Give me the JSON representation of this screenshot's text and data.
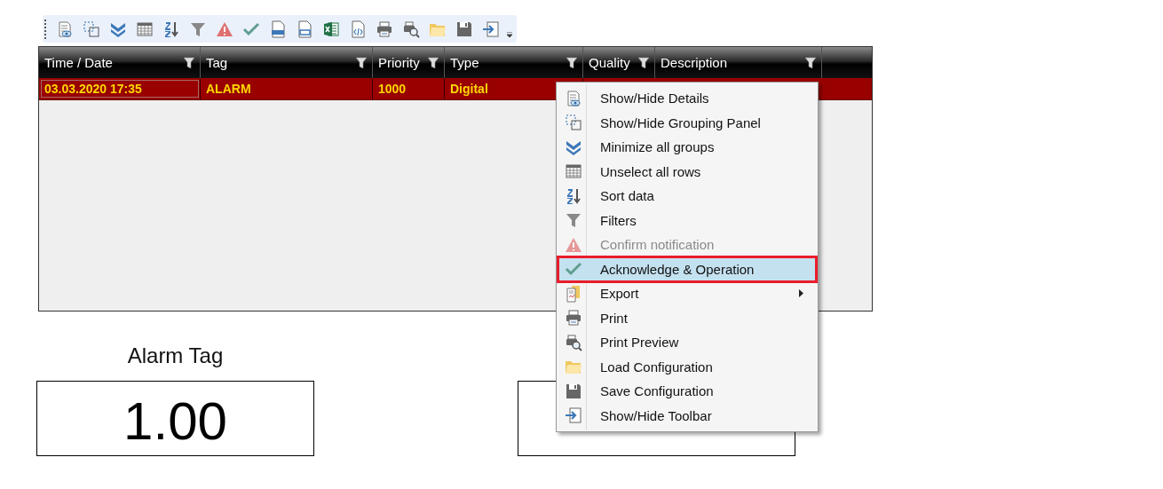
{
  "toolbar": {
    "buttons": [
      {
        "kind": "details"
      },
      {
        "kind": "grouping"
      },
      {
        "kind": "collapse"
      },
      {
        "kind": "unselect"
      },
      {
        "kind": "sort"
      },
      {
        "kind": "filter"
      },
      {
        "kind": "warning"
      },
      {
        "kind": "check"
      },
      {
        "kind": "txt"
      },
      {
        "kind": "csv"
      },
      {
        "kind": "excel"
      },
      {
        "kind": "code"
      },
      {
        "kind": "print"
      },
      {
        "kind": "preview"
      },
      {
        "kind": "folder"
      },
      {
        "kind": "save"
      },
      {
        "kind": "toolbar"
      }
    ]
  },
  "table": {
    "columns": [
      {
        "label": "Time / Date"
      },
      {
        "label": "Tag"
      },
      {
        "label": "Priority"
      },
      {
        "label": "Type"
      },
      {
        "label": "Quality"
      },
      {
        "label": "Description"
      }
    ],
    "rows": [
      {
        "cells": [
          {
            "text": "03.03.2020 17:35",
            "focused": true
          },
          {
            "text": "ALARM",
            "focused": false
          },
          {
            "text": "1000",
            "focused": false
          },
          {
            "text": "Digital",
            "focused": false
          }
        ]
      }
    ]
  },
  "context_menu": {
    "items": [
      {
        "label": "Show/Hide Details",
        "kind": "details",
        "disabled": false,
        "selected": false,
        "submenu": false
      },
      {
        "label": "Show/Hide Grouping Panel",
        "kind": "grouping",
        "disabled": false,
        "selected": false,
        "submenu": false
      },
      {
        "label": "Minimize all groups",
        "kind": "collapse",
        "disabled": false,
        "selected": false,
        "submenu": false
      },
      {
        "label": "Unselect all rows",
        "kind": "unselect",
        "disabled": false,
        "selected": false,
        "submenu": false
      },
      {
        "label": "Sort data",
        "kind": "sort",
        "disabled": false,
        "selected": false,
        "submenu": false
      },
      {
        "label": "Filters",
        "kind": "filter",
        "disabled": false,
        "selected": false,
        "submenu": false
      },
      {
        "label": "Confirm notification",
        "kind": "warning",
        "disabled": true,
        "selected": false,
        "submenu": false
      },
      {
        "label": "Acknowledge & Operation",
        "kind": "check",
        "disabled": false,
        "selected": true,
        "submenu": false
      },
      {
        "label": "Export",
        "kind": "export",
        "disabled": false,
        "selected": false,
        "submenu": true
      },
      {
        "label": "Print",
        "kind": "print",
        "disabled": false,
        "selected": false,
        "submenu": false
      },
      {
        "label": "Print Preview",
        "kind": "preview",
        "disabled": false,
        "selected": false,
        "submenu": false
      },
      {
        "label": "Load Configuration",
        "kind": "folder",
        "disabled": false,
        "selected": false,
        "submenu": false
      },
      {
        "label": "Save Configuration",
        "kind": "save",
        "disabled": false,
        "selected": false,
        "submenu": false
      },
      {
        "label": "Show/Hide Toolbar",
        "kind": "toolbar",
        "disabled": false,
        "selected": false,
        "submenu": false
      }
    ]
  },
  "panels": [
    {
      "kind": "display",
      "label": "Alarm Tag",
      "value": "1.00"
    },
    {
      "kind": "display"
    }
  ]
}
